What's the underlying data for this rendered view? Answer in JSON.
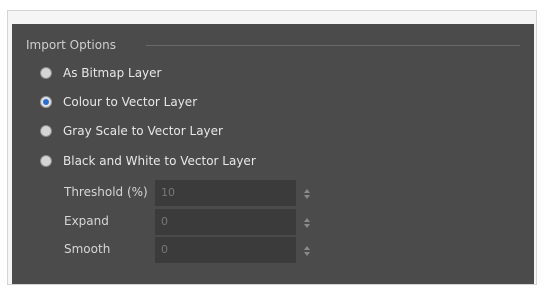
{
  "group": {
    "title": "Import Options"
  },
  "radios": [
    {
      "label": "As Bitmap Layer",
      "checked": false
    },
    {
      "label": "Colour to Vector Layer",
      "checked": true
    },
    {
      "label": "Gray Scale to Vector Layer",
      "checked": false
    },
    {
      "label": "Black and White to Vector Layer",
      "checked": false
    }
  ],
  "fields": [
    {
      "label": "Threshold (%)",
      "value": "10",
      "disabled": true
    },
    {
      "label": "Expand",
      "value": "0",
      "disabled": true
    },
    {
      "label": "Smooth",
      "value": "0",
      "disabled": true
    }
  ],
  "colors": {
    "panel_bg": "#4b4b4b",
    "input_bg": "#3b3b3b",
    "accent": "#2a6fd0"
  },
  "icons": {
    "spinner": "spin-up-down-icon",
    "radio": "radio-button-icon"
  }
}
